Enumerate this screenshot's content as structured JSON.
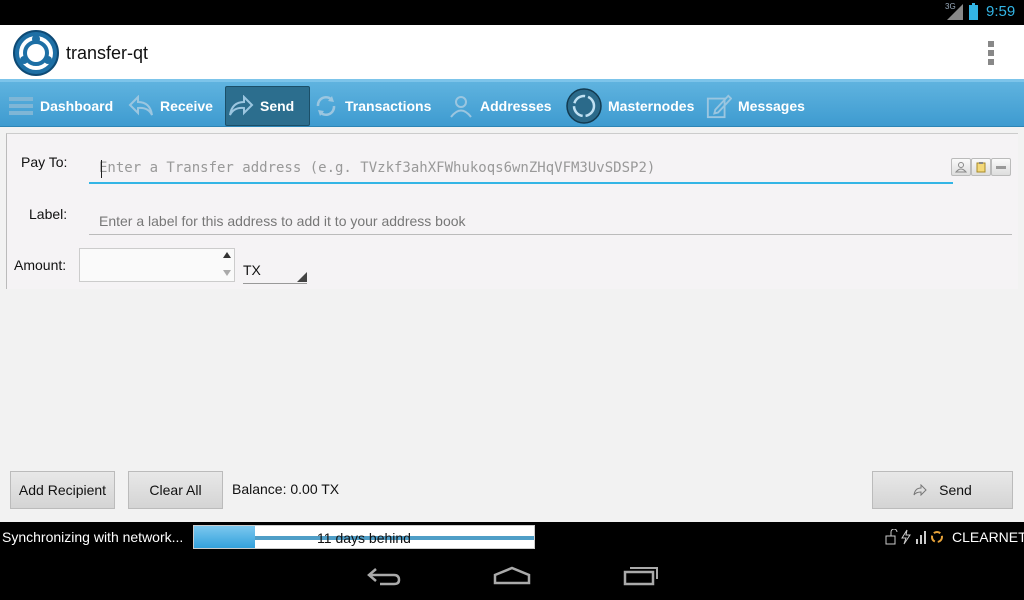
{
  "status_bar": {
    "network": "3G",
    "time": "9:59",
    "accent": "#33b5e5"
  },
  "app": {
    "title": "transfer-qt"
  },
  "toolbar": {
    "items": [
      {
        "label": "Dashboard",
        "icon": "dashboard-icon"
      },
      {
        "label": "Receive",
        "icon": "receive-arrow-icon"
      },
      {
        "label": "Send",
        "icon": "send-arrow-icon",
        "active": true
      },
      {
        "label": "Transactions",
        "icon": "transactions-icon"
      },
      {
        "label": "Addresses",
        "icon": "person-icon"
      },
      {
        "label": "Masternodes",
        "icon": "masternode-icon"
      },
      {
        "label": "Messages",
        "icon": "pencil-icon"
      }
    ]
  },
  "form": {
    "pay_to_label": "Pay To:",
    "pay_to_placeholder": "Enter a Transfer address (e.g. TVzkf3ahXFWhukoqs6wnZHqVFM3UvSDSP2)",
    "label_label": "Label:",
    "label_placeholder": "Enter a label for this address to add it to your address book",
    "amount_label": "Amount:",
    "amount_value": "",
    "unit": "TX"
  },
  "buttons": {
    "add_recipient": "Add Recipient",
    "clear_all": "Clear All",
    "send": "Send"
  },
  "balance_text": "Balance: 0.00 TX",
  "sync": {
    "text": "Synchronizing with network...",
    "progress_label": "11 days behind",
    "progress_fraction": 0.18
  },
  "network": {
    "mode": "CLEARNET"
  }
}
